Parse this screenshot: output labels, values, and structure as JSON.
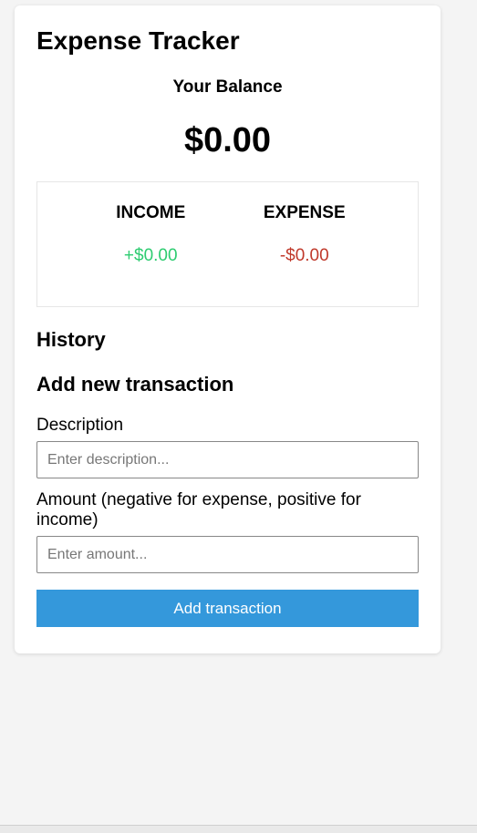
{
  "app": {
    "title": "Expense Tracker"
  },
  "balance": {
    "label": "Your Balance",
    "value": "$0.00"
  },
  "summary": {
    "income_label": "INCOME",
    "income_value": "+$0.00",
    "expense_label": "EXPENSE",
    "expense_value": "-$0.00"
  },
  "history": {
    "heading": "History"
  },
  "form": {
    "heading": "Add new transaction",
    "description_label": "Description",
    "description_placeholder": "Enter description...",
    "description_value": "",
    "amount_label": "Amount (negative for expense, positive for income)",
    "amount_placeholder": "Enter amount...",
    "amount_value": "",
    "submit_label": "Add transaction"
  },
  "colors": {
    "income": "#2ecc71",
    "expense": "#c0392b",
    "button": "#3498db"
  }
}
